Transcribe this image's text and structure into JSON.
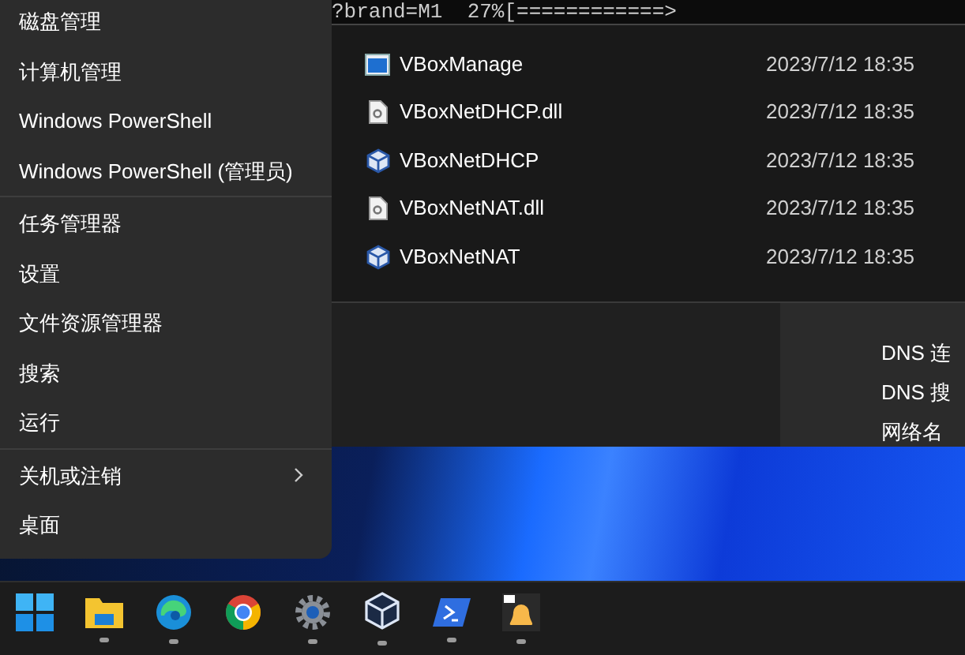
{
  "terminal": {
    "text": "?brand=M1  27%[============>"
  },
  "files": [
    {
      "name": "VBoxManage",
      "date": "2023/7/12 18:35",
      "kind": "exe"
    },
    {
      "name": "VBoxNetDHCP.dll",
      "date": "2023/7/12 18:35",
      "kind": "dll"
    },
    {
      "name": "VBoxNetDHCP",
      "date": "2023/7/12 18:35",
      "kind": "cube"
    },
    {
      "name": "VBoxNetNAT.dll",
      "date": "2023/7/12 18:35",
      "kind": "dll"
    },
    {
      "name": "VBoxNetNAT",
      "date": "2023/7/12 18:35",
      "kind": "cube"
    }
  ],
  "side_panel": {
    "items": [
      "DNS 连",
      "DNS 搜",
      "网络名"
    ]
  },
  "menu": {
    "groups": [
      [
        {
          "label": "磁盘管理",
          "submenu": false
        },
        {
          "label": "计算机管理",
          "submenu": false
        },
        {
          "label": "Windows PowerShell",
          "submenu": false
        },
        {
          "label": "Windows PowerShell (管理员)",
          "submenu": false
        }
      ],
      [
        {
          "label": "任务管理器",
          "submenu": false
        },
        {
          "label": "设置",
          "submenu": false
        },
        {
          "label": "文件资源管理器",
          "submenu": false
        },
        {
          "label": "搜索",
          "submenu": false
        },
        {
          "label": "运行",
          "submenu": false
        }
      ],
      [
        {
          "label": "关机或注销",
          "submenu": true
        },
        {
          "label": "桌面",
          "submenu": false
        }
      ]
    ]
  },
  "taskbar": [
    {
      "kind": "start",
      "running": false
    },
    {
      "kind": "folder",
      "running": true
    },
    {
      "kind": "edge",
      "running": true
    },
    {
      "kind": "chrome",
      "running": false
    },
    {
      "kind": "gear",
      "running": true
    },
    {
      "kind": "cube",
      "running": true
    },
    {
      "kind": "terminal",
      "running": true
    },
    {
      "kind": "bell",
      "running": true
    }
  ]
}
